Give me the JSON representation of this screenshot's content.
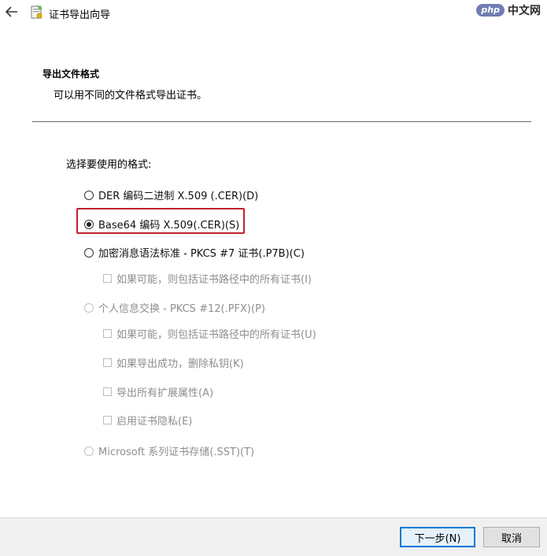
{
  "window": {
    "title": "证书导出向导",
    "watermark_php": "php",
    "watermark_cn": "中文网"
  },
  "section": {
    "header": "导出文件格式",
    "description": "可以用不同的文件格式导出证书。"
  },
  "format_prompt": "选择要使用的格式:",
  "options": {
    "der": {
      "label": "DER 编码二进制 X.509 (.CER)(D)",
      "selected": false,
      "enabled": true
    },
    "base64": {
      "label": "Base64 编码 X.509(.CER)(S)",
      "selected": true,
      "enabled": true
    },
    "pkcs7": {
      "label": "加密消息语法标准 - PKCS #7 证书(.P7B)(C)",
      "selected": false,
      "enabled": true
    },
    "pkcs7_include_all": {
      "label": "如果可能，则包括证书路径中的所有证书(I)",
      "checked": false,
      "enabled": false
    },
    "pfx": {
      "label": "个人信息交换 - PKCS #12(.PFX)(P)",
      "selected": false,
      "enabled": false
    },
    "pfx_include_all": {
      "label": "如果可能，则包括证书路径中的所有证书(U)",
      "checked": false,
      "enabled": false
    },
    "pfx_delete_key": {
      "label": "如果导出成功，删除私钥(K)",
      "checked": false,
      "enabled": false
    },
    "pfx_export_ext": {
      "label": "导出所有扩展属性(A)",
      "checked": false,
      "enabled": false
    },
    "pfx_privacy": {
      "label": "启用证书隐私(E)",
      "checked": false,
      "enabled": false
    },
    "sst": {
      "label": "Microsoft 系列证书存储(.SST)(T)",
      "selected": false,
      "enabled": false
    }
  },
  "buttons": {
    "next": "下一步(N)",
    "cancel": "取消"
  },
  "colors": {
    "highlight": "#c2202e",
    "focus_border": "#0078d7",
    "disabled_text": "#8e8e8e"
  }
}
